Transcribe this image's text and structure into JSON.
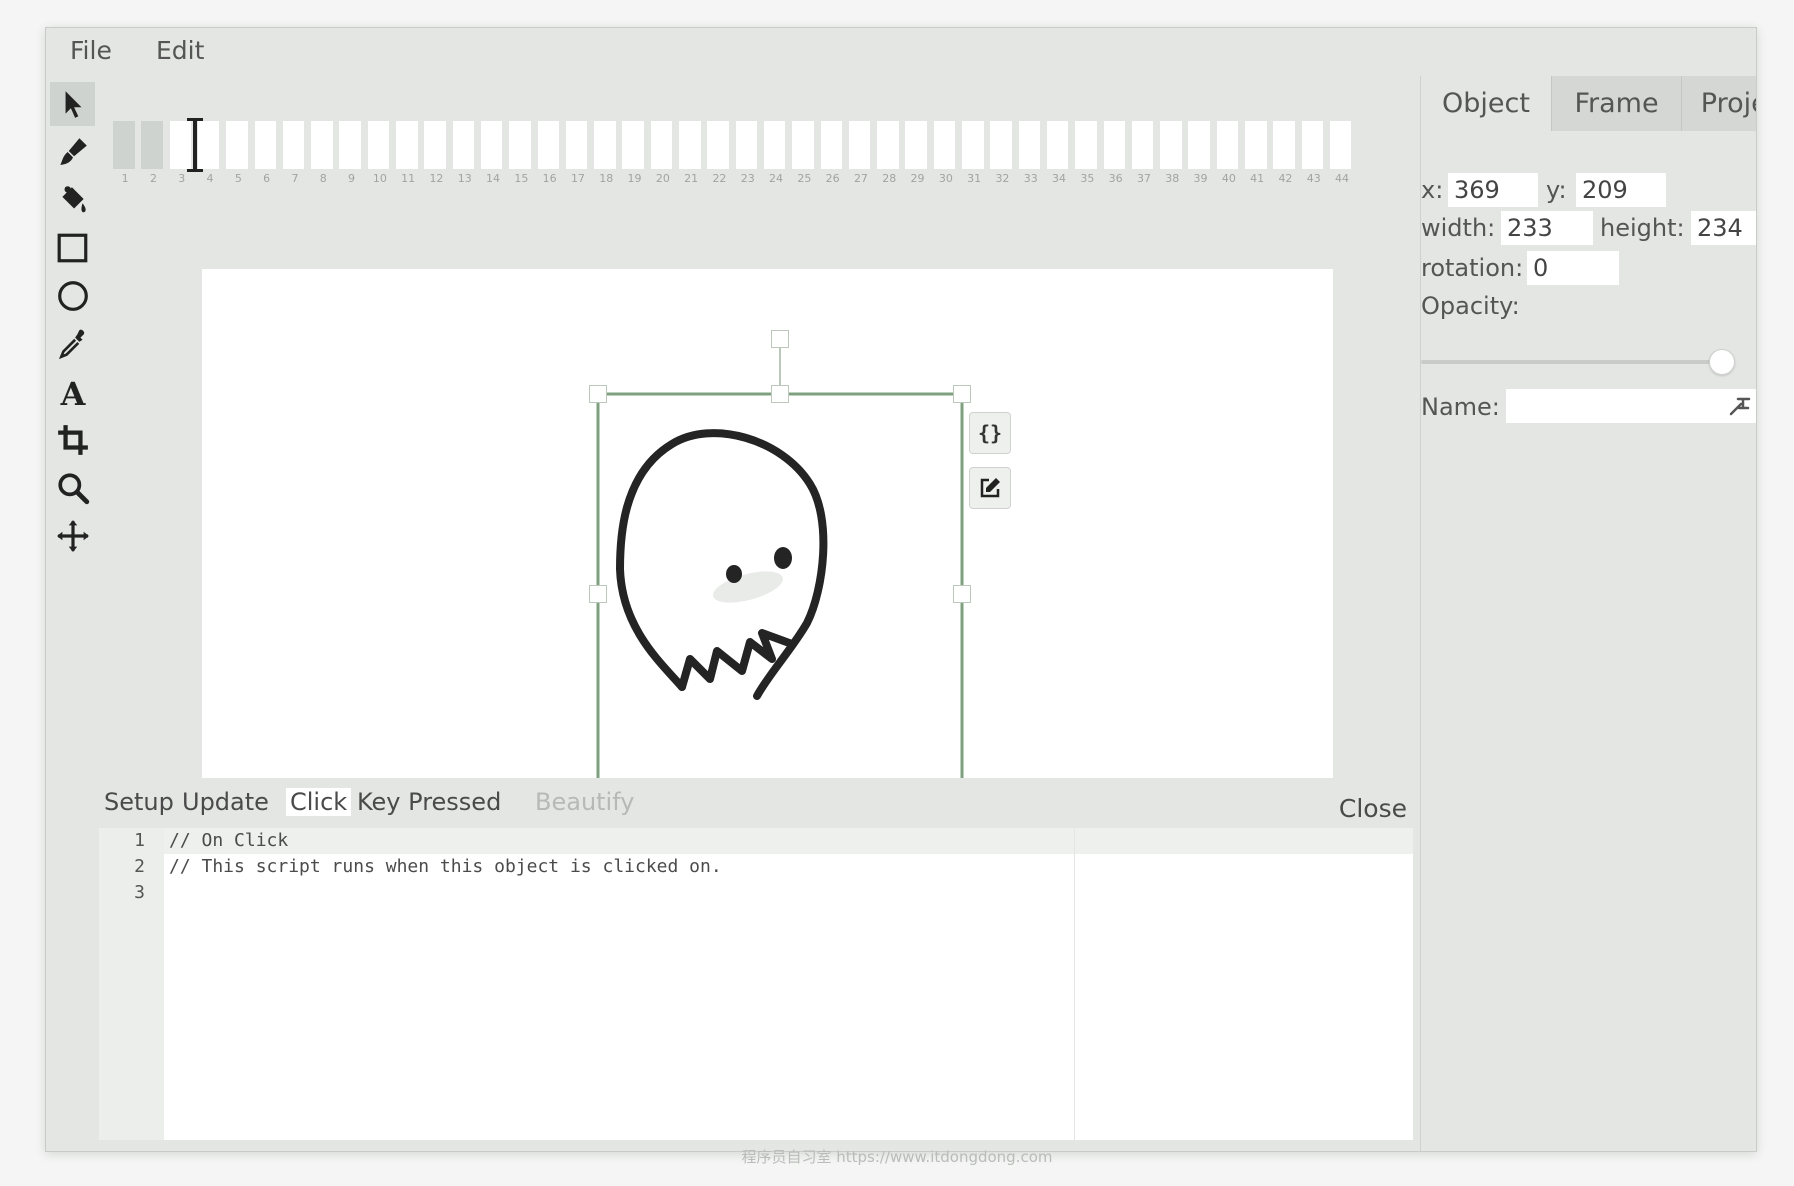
{
  "menu": {
    "file": "File",
    "edit": "Edit"
  },
  "tools": [
    {
      "name": "cursor-icon",
      "tip": "select"
    },
    {
      "name": "brush-icon",
      "tip": "brush"
    },
    {
      "name": "paint-bucket-icon",
      "tip": "fill"
    },
    {
      "name": "rectangle-icon",
      "tip": "rectangle"
    },
    {
      "name": "ellipse-icon",
      "tip": "ellipse"
    },
    {
      "name": "eyedropper-icon",
      "tip": "eyedropper"
    },
    {
      "name": "text-icon",
      "tip": "text"
    },
    {
      "name": "crop-icon",
      "tip": "crop"
    },
    {
      "name": "zoom-icon",
      "tip": "zoom"
    },
    {
      "name": "pan-icon",
      "tip": "pan"
    }
  ],
  "timeline": {
    "frame_numbers": [
      1,
      2,
      3,
      4,
      5,
      6,
      7,
      8,
      9,
      10,
      11,
      12,
      13,
      14,
      15,
      16,
      17,
      18,
      19,
      20,
      21,
      22,
      23,
      24,
      25,
      26,
      27,
      28,
      29,
      30,
      31,
      32,
      33,
      34,
      35,
      36,
      37,
      38,
      39,
      40,
      41,
      42,
      43,
      44
    ],
    "current_frame": 2
  },
  "stage": {
    "selection_buttons": {
      "script": "{}",
      "edit": "edit-icon"
    }
  },
  "editor": {
    "tabs": [
      "Setup",
      "Update",
      "Click",
      "Key Pressed",
      "Beautify"
    ],
    "active_tab": "Click",
    "close_label": "Close",
    "lines": [
      {
        "num": "1",
        "text": "// On Click"
      },
      {
        "num": "2",
        "text": "// This script runs when this object is clicked on."
      },
      {
        "num": "3",
        "text": ""
      }
    ]
  },
  "inspector": {
    "tabs": [
      "Object",
      "Frame",
      "Project"
    ],
    "active_tab": "Object",
    "x_label": "x:",
    "x_value": "369",
    "y_label": "y:",
    "y_value": "209",
    "width_label": "width:",
    "width_value": "233",
    "height_label": "height:",
    "height_value": "234",
    "rotation_label": "rotation:",
    "rotation_value": "0",
    "opacity_label": "Opacity:",
    "opacity_value": 1.0,
    "name_label": "Name:",
    "name_value": ""
  },
  "watermark": "程序员自习室 https://www.itdongdong.com"
}
